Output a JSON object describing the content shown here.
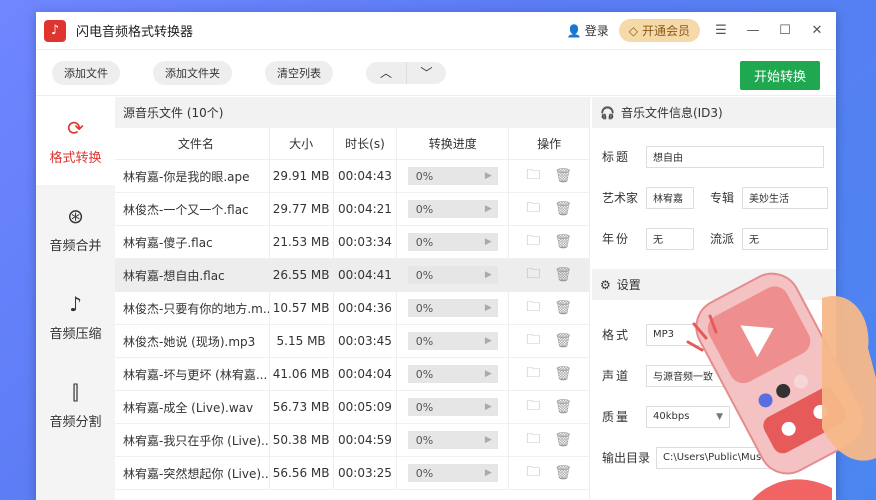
{
  "app": {
    "title": "闪电音频格式转换器"
  },
  "titlebar": {
    "login": "登录",
    "vip": "开通会员"
  },
  "toolbar": {
    "add_file": "添加文件",
    "add_folder": "添加文件夹",
    "clear_list": "清空列表",
    "start": "开始转换"
  },
  "sidebar": {
    "items": [
      {
        "label": "格式转换",
        "icon": "refresh-icon"
      },
      {
        "label": "音频合并",
        "icon": "merge-icon"
      },
      {
        "label": "音频压缩",
        "icon": "compress-icon"
      },
      {
        "label": "音频分割",
        "icon": "split-icon"
      }
    ]
  },
  "filelist": {
    "header": "源音乐文件 (10个)",
    "columns": [
      "文件名",
      "大小",
      "时长(s)",
      "转换进度",
      "操作"
    ],
    "rows": [
      {
        "name": "林宥嘉-你是我的眼.ape",
        "size": "29.91 MB",
        "duration": "00:04:43",
        "progress": "0%"
      },
      {
        "name": "林俊杰-一个又一个.flac",
        "size": "29.77 MB",
        "duration": "00:04:21",
        "progress": "0%"
      },
      {
        "name": "林宥嘉-傻子.flac",
        "size": "21.53 MB",
        "duration": "00:03:34",
        "progress": "0%"
      },
      {
        "name": "林宥嘉-想自由.flac",
        "size": "26.55 MB",
        "duration": "00:04:41",
        "progress": "0%"
      },
      {
        "name": "林俊杰-只要有你的地方.m...",
        "size": "10.57 MB",
        "duration": "00:04:36",
        "progress": "0%"
      },
      {
        "name": "林俊杰-她说 (现场).mp3",
        "size": "5.15 MB",
        "duration": "00:03:45",
        "progress": "0%"
      },
      {
        "name": "林宥嘉-坏与更坏 (林宥嘉...",
        "size": "41.06 MB",
        "duration": "00:04:04",
        "progress": "0%"
      },
      {
        "name": "林宥嘉-成全 (Live).wav",
        "size": "56.73 MB",
        "duration": "00:05:09",
        "progress": "0%"
      },
      {
        "name": "林宥嘉-我只在乎你 (Live)....",
        "size": "50.38 MB",
        "duration": "00:04:59",
        "progress": "0%"
      },
      {
        "name": "林宥嘉-突然想起你 (Live)....",
        "size": "56.56 MB",
        "duration": "00:03:25",
        "progress": "0%"
      }
    ]
  },
  "id3": {
    "header": "音乐文件信息(ID3)",
    "title_label": "标题",
    "title_value": "想自由",
    "artist_label": "艺术家",
    "artist_value": "林宥嘉",
    "album_label": "专辑",
    "album_value": "美妙生活",
    "year_label": "年份",
    "year_value": "无",
    "genre_label": "流派",
    "genre_value": "无"
  },
  "settings": {
    "header": "设置",
    "format_label": "格式",
    "format_value": "MP3",
    "channel_label": "声道",
    "channel_value": "与源音频一致",
    "quality_label": "质量",
    "quality_value": "40kbps",
    "output_label": "输出目录",
    "output_value": "C:\\Users\\Public\\Music\\"
  },
  "colors": {
    "accent": "#e0352f",
    "start": "#1fa84f",
    "vip_bg": "#f6d9a8",
    "background": "#5b7cf5"
  }
}
